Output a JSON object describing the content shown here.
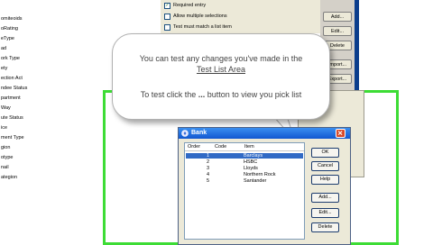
{
  "tree": {
    "items": [
      "omiteoids",
      "oRating",
      "eType",
      "ad",
      "ork Type",
      "ety",
      "ection Act",
      "ndee Status",
      "partment",
      "Way",
      "ute Status",
      "ice",
      "ment Type",
      "gion",
      "otype",
      "nail",
      "ategion"
    ]
  },
  "settings": {
    "checks": [
      {
        "label": "Required entry",
        "checked": true
      },
      {
        "label": "Allow multiple selections",
        "checked": false
      },
      {
        "label": "Test must match a list item",
        "checked": false
      }
    ]
  },
  "side_buttons": [
    "Add...",
    "Edit...",
    "Delete",
    "Import...",
    "Export..."
  ],
  "callout": {
    "line1": "You can test any changes you've made in the",
    "line2": "Test List Area",
    "line3_before": "To test click the ",
    "line3_bold": "...",
    "line3_after": " button to view you pick list"
  },
  "dialog": {
    "title": "Bank",
    "columns": {
      "order": "Order",
      "code": "Code",
      "item": "Item"
    },
    "rows": [
      {
        "order": "1",
        "code": "",
        "item": "Barclays",
        "selected": true
      },
      {
        "order": "2",
        "code": "",
        "item": "HSBC",
        "selected": false
      },
      {
        "order": "3",
        "code": "",
        "item": "Lloyds",
        "selected": false
      },
      {
        "order": "4",
        "code": "",
        "item": "Northern Rock",
        "selected": false
      },
      {
        "order": "5",
        "code": "",
        "item": "Santander",
        "selected": false
      }
    ],
    "buttons": {
      "ok": "OK",
      "cancel": "Cancel",
      "help": "Help",
      "add": "Add...",
      "edit": "Edit...",
      "delete": "Delete"
    }
  },
  "colors": {
    "highlight": "#3ddc35",
    "selection": "#316ac5",
    "titlebar": "#1157d0"
  }
}
